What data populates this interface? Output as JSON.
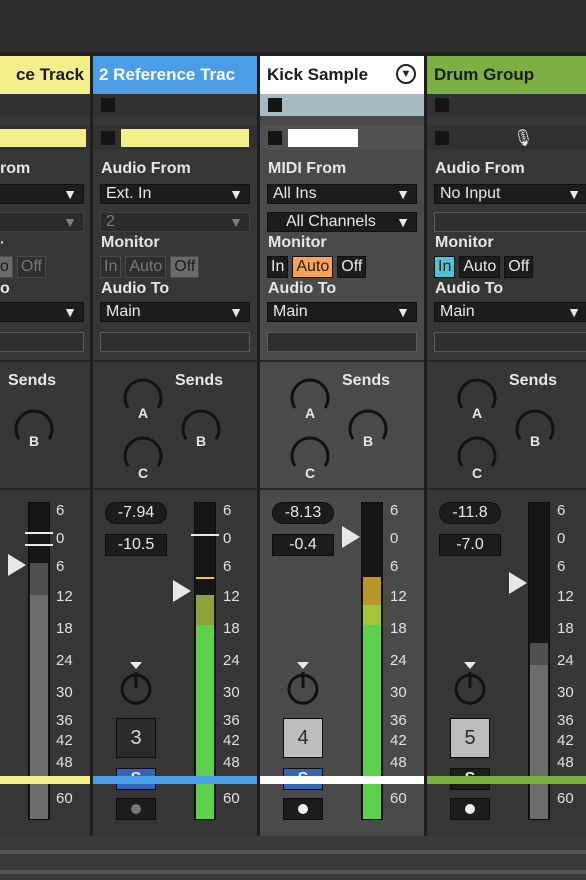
{
  "tracks": [
    {
      "name": "ce Track",
      "header_color": "#f3ee8a",
      "audio_from_label": "rom",
      "mon_label": "",
      "mon_off": "Off",
      "mon_auto_part": "o",
      "audio_to_label": "o",
      "sends_label": "Sends",
      "send_b": "B",
      "meter_ticks": [
        "6",
        "0",
        "6",
        "12",
        "18",
        "24",
        "30",
        "36",
        "42",
        "48",
        "60"
      ],
      "color": "#f3ee8a"
    },
    {
      "name": "2 Reference Trac",
      "header_color": "#4b9ee6",
      "audio_from_label": "Audio From",
      "input_type": "Ext. In",
      "input_channel": "2",
      "monitor_label": "Monitor",
      "mon_in": "In",
      "mon_auto": "Auto",
      "mon_off": "Off",
      "audio_to_label": "Audio To",
      "audio_to": "Main",
      "sends_label": "Sends",
      "send_a": "A",
      "send_b": "B",
      "send_c": "C",
      "peak": "-7.94",
      "volume": "-10.5",
      "track_number": "3",
      "solo": "S",
      "meter_ticks": [
        "6",
        "0",
        "6",
        "12",
        "18",
        "24",
        "30",
        "36",
        "42",
        "48",
        "60"
      ],
      "color": "#4b9ee6"
    },
    {
      "name": "Kick Sample",
      "header_color": "#ffffff",
      "midi_from_label": "MIDI From",
      "input_type": "All Ins",
      "input_channel": "All Channels",
      "monitor_label": "Monitor",
      "mon_in": "In",
      "mon_auto": "Auto",
      "mon_off": "Off",
      "audio_to_label": "Audio To",
      "audio_to": "Main",
      "sends_label": "Sends",
      "send_a": "A",
      "send_b": "B",
      "send_c": "C",
      "peak": "-8.13",
      "volume": "-0.4",
      "track_number": "4",
      "solo": "S",
      "meter_ticks": [
        "6",
        "0",
        "6",
        "12",
        "18",
        "24",
        "30",
        "36",
        "42",
        "48",
        "60"
      ],
      "color": "#ffffff"
    },
    {
      "name": "Drum Group",
      "header_color": "#7cb043",
      "audio_from_label": "Audio From",
      "input_type": "No Input",
      "monitor_label": "Monitor",
      "mon_in": "In",
      "mon_auto": "Auto",
      "mon_off": "Off",
      "audio_to_label": "Audio To",
      "audio_to": "Main",
      "sends_label": "Sends",
      "send_a": "A",
      "send_b": "B",
      "send_c": "C",
      "peak": "-11.8",
      "volume": "-7.0",
      "track_number": "5",
      "solo": "S",
      "meter_ticks": [
        "6",
        "0",
        "6",
        "12",
        "18",
        "24",
        "30",
        "36",
        "42",
        "48",
        "60"
      ],
      "color": "#7cb043"
    }
  ],
  "icons": {
    "fold": "chevron-down-circle-icon",
    "mic": "microphone-icon",
    "dropdown": "triangle-down-icon"
  }
}
